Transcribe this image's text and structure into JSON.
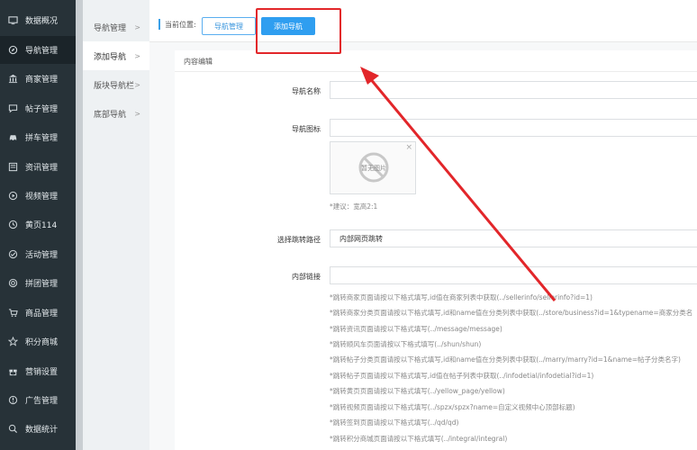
{
  "sidebar": {
    "items": [
      {
        "label": "数据概况",
        "icon": "monitor-icon"
      },
      {
        "label": "导航管理",
        "icon": "compass-icon",
        "active": true
      },
      {
        "label": "商家管理",
        "icon": "bank-icon"
      },
      {
        "label": "帖子管理",
        "icon": "chat-icon"
      },
      {
        "label": "拼车管理",
        "icon": "car-icon"
      },
      {
        "label": "资讯管理",
        "icon": "news-icon"
      },
      {
        "label": "视频管理",
        "icon": "video-icon"
      },
      {
        "label": "黄页114",
        "icon": "yellow-page-icon"
      },
      {
        "label": "活动管理",
        "icon": "activity-icon"
      },
      {
        "label": "拼团管理",
        "icon": "group-icon"
      },
      {
        "label": "商品管理",
        "icon": "cart-icon"
      },
      {
        "label": "积分商城",
        "icon": "star-icon"
      },
      {
        "label": "营销设置",
        "icon": "gift-icon"
      },
      {
        "label": "广告管理",
        "icon": "ad-icon"
      },
      {
        "label": "数据统计",
        "icon": "stats-icon"
      }
    ]
  },
  "subnav": {
    "items": [
      {
        "label": "导航管理"
      },
      {
        "label": "添加导航",
        "active": true
      },
      {
        "label": "版块导航栏"
      },
      {
        "label": "底部导航"
      }
    ]
  },
  "header": {
    "location_label": "当前位置:",
    "tabs": [
      {
        "label": "导航管理"
      },
      {
        "label": "添加导航"
      }
    ]
  },
  "form": {
    "section_title": "内容编辑",
    "nav_name_label": "导航名称",
    "nav_name_value": "",
    "nav_icon_label": "导航图标",
    "icon_placeholder_text": "暂无图片",
    "icon_close": "×",
    "icon_hint": "*建议：宽高2:1",
    "route_label": "选择跳转路径",
    "route_value": "内部网页跳转",
    "link_label": "内部链接",
    "link_value": "",
    "hints": [
      "*跳转商家页面请按以下格式填写,id值在商家列表中获取(../sellerinfo/sellerinfo?id=1)",
      "*跳转商家分类页面请按以下格式填写,id和name值在分类列表中获取(../store/business?id=1&typename=商家分类名",
      "*跳转资讯页面请按以下格式填写(../message/message)",
      "*跳转顺风车页面请按以下格式填写(../shun/shun)",
      "*跳转帖子分类页面请按以下格式填写,id和name值在分类列表中获取(../marry/marry?id=1&name=帖子分类名字)",
      "*跳转帖子页面请按以下格式填写,id值在帖子列表中获取(../infodetial/infodetial?id=1)",
      "*跳转黄页页面请按以下格式填写(../yellow_page/yellow)",
      "*跳转视频页面请按以下格式填写(../spzx/spzx?name=自定义视频中心顶部标题)",
      "*跳转签到页面请按以下格式填写(../qd/qd)",
      "*跳转积分商城页面请按以下格式填写(../integral/integral)"
    ]
  },
  "colors": {
    "sidebar_bg": "#273238",
    "accent": "#2f9ef0",
    "annotation_red": "#e2262a"
  }
}
